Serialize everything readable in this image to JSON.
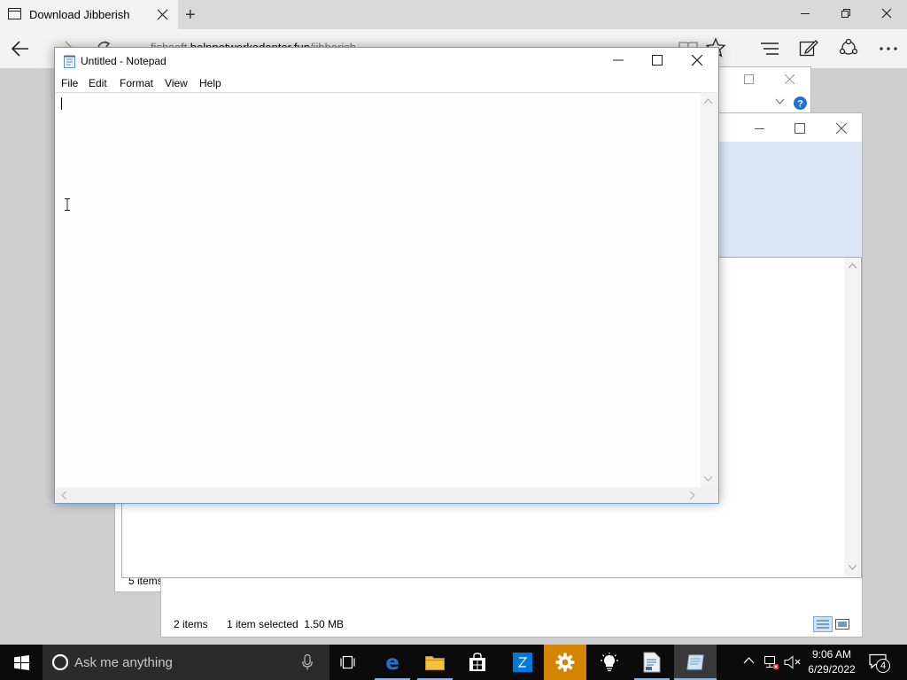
{
  "browser": {
    "tab_title": "Download Jibberish",
    "new_tab": "+",
    "address": {
      "prefix": "fishsoft.",
      "host": "helpnetworkadapter.fun",
      "path": "/jibberish"
    }
  },
  "explorer_a": {
    "status_items": "5 items"
  },
  "explorer_b": {
    "status_items": "2 items",
    "status_selected": "1 item selected  1.50 MB"
  },
  "notepad": {
    "title": "Untitled - Notepad",
    "menus": [
      "File",
      "Edit",
      "Format",
      "View",
      "Help"
    ],
    "content": ""
  },
  "taskbar": {
    "search_placeholder": "Ask me anything",
    "time": "9:06 AM",
    "date": "6/29/2022",
    "notification_count": "4"
  },
  "colors": {
    "taskbar": "#0b0b0b",
    "edge_blue": "#1e73d2",
    "store_blue": "#0078d7",
    "settings_orange": "#d58400",
    "notepad_border": "#6e9ed4"
  },
  "icons": {
    "tab": "tab-page-icon",
    "close": "close-icon",
    "back": "back-arrow-icon",
    "forward": "forward-arrow-icon",
    "refresh": "refresh-icon",
    "reading_view": "book-icon",
    "favorite": "star-icon",
    "hub": "hub-icon",
    "notes": "pen-icon",
    "share": "share-icon",
    "more": "more-icon",
    "windows": "windows-logo-icon",
    "cortana": "cortana-ring-icon",
    "microphone": "microphone-icon",
    "task_view": "task-view-icon",
    "edge": "edge-icon",
    "file_explorer": "folder-icon",
    "store": "store-icon",
    "settings": "gear-icon",
    "tips": "lightbulb-icon",
    "notepad": "notepad-icon"
  }
}
